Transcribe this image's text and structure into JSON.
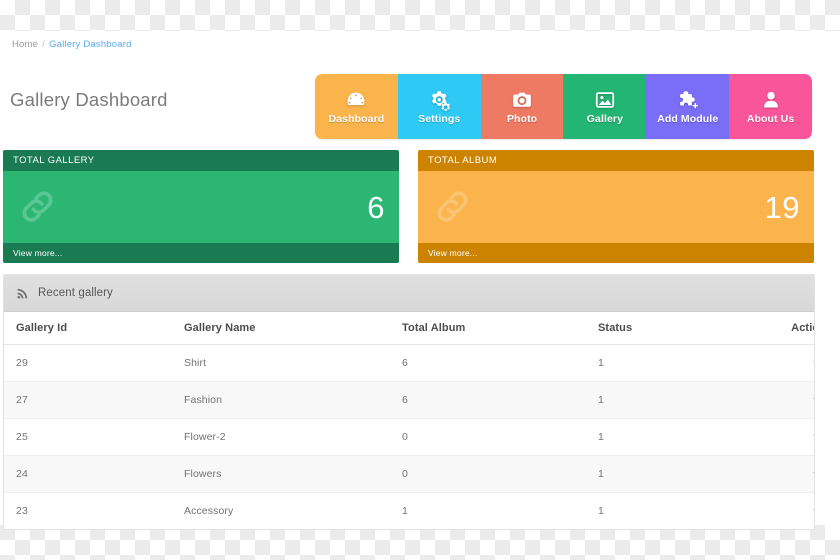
{
  "breadcrumb": {
    "home": "Home",
    "separator": "/",
    "current": "Gallery Dashboard"
  },
  "page": {
    "title": "Gallery Dashboard"
  },
  "topnav": {
    "items": [
      {
        "label": "Dashboard",
        "icon": "dashboard-icon",
        "color": "#fbb44c"
      },
      {
        "label": "Settings",
        "icon": "gears-icon",
        "color": "#2ec9f5"
      },
      {
        "label": "Photo",
        "icon": "camera-icon",
        "color": "#ee7a63"
      },
      {
        "label": "Gallery",
        "icon": "image-icon",
        "color": "#22b573"
      },
      {
        "label": "Add Module",
        "icon": "puzzle-plus-icon",
        "color": "#7b6ef6"
      },
      {
        "label": "About Us",
        "icon": "user-icon",
        "color": "#f9559b"
      }
    ]
  },
  "cards": [
    {
      "title": "TOTAL GALLERY",
      "value": "6",
      "footer": "View more...",
      "icon": "chain-link-icon",
      "head_color": "#1a7a52",
      "body_color": "#2cb674"
    },
    {
      "title": "TOTAL ALBUM",
      "value": "19",
      "footer": "View more...",
      "icon": "chain-link-icon",
      "head_color": "#cc8400",
      "body_color": "#fbb44c"
    }
  ],
  "panel": {
    "title": "Recent gallery",
    "icon": "rss-icon",
    "table": {
      "columns": [
        "Gallery Id",
        "Gallery Name",
        "Total Album",
        "Status",
        "Action"
      ],
      "rows": [
        {
          "id": "29",
          "name": "Shirt",
          "total_album": "6",
          "status": "1",
          "action_icon": "eye-icon"
        },
        {
          "id": "27",
          "name": "Fashion",
          "total_album": "6",
          "status": "1",
          "action_icon": "eye-icon"
        },
        {
          "id": "25",
          "name": "Flower-2",
          "total_album": "0",
          "status": "1",
          "action_icon": "eye-icon"
        },
        {
          "id": "24",
          "name": "Flowers",
          "total_album": "0",
          "status": "1",
          "action_icon": "eye-icon"
        },
        {
          "id": "23",
          "name": "Accessory",
          "total_album": "1",
          "status": "1",
          "action_icon": "eye-icon"
        }
      ]
    }
  },
  "colors": {
    "accent_link": "#5aa9f0",
    "eye_icon": "#2f8fd8"
  }
}
